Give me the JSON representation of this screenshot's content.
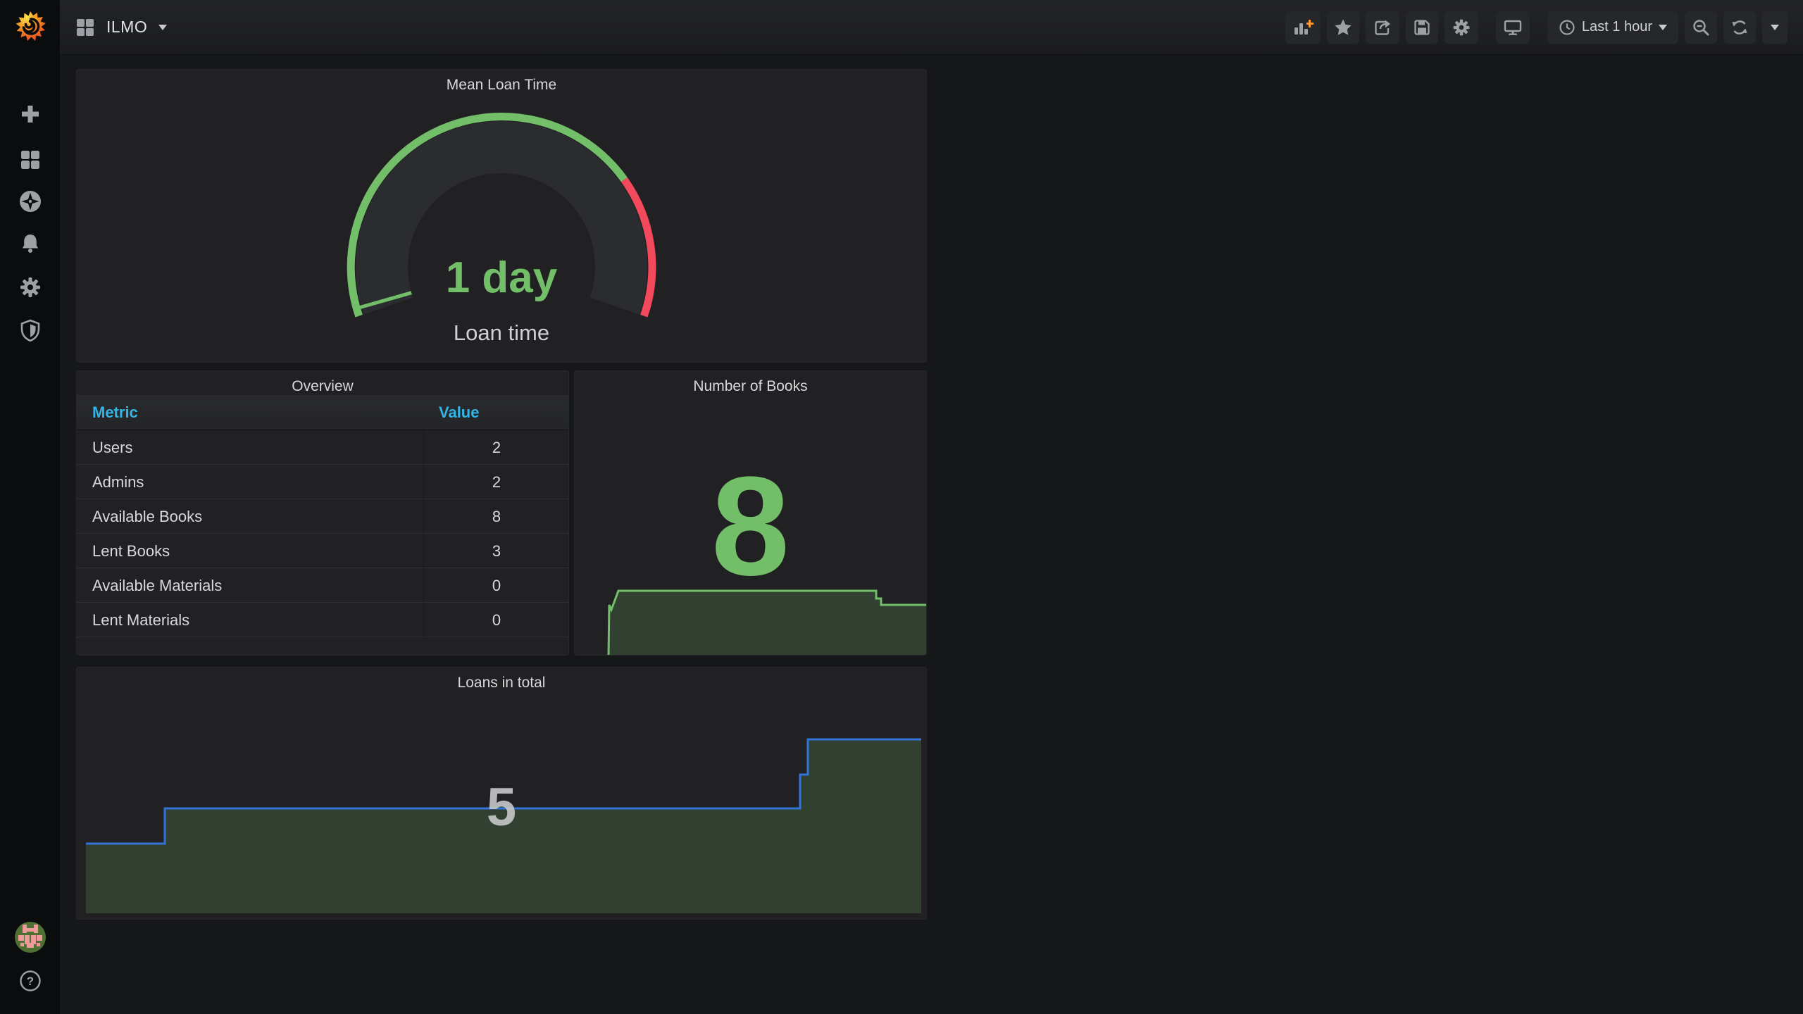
{
  "app": {
    "name": "Grafana"
  },
  "navbar": {
    "dashboard_title": "ILMO",
    "time_picker": {
      "label": "Last 1 hour"
    }
  },
  "sidebar": {
    "items": [
      "create",
      "dashboards",
      "explore",
      "alerting",
      "configuration",
      "server-admin"
    ],
    "bottom_items": [
      "user-avatar",
      "help"
    ]
  },
  "panels": {
    "mean_loan_time": {
      "title": "Mean Loan Time",
      "value": "1 day",
      "label": "Loan time"
    },
    "overview": {
      "title": "Overview",
      "columns": [
        "Metric",
        "Value"
      ],
      "rows": [
        [
          "Users",
          "2"
        ],
        [
          "Admins",
          "2"
        ],
        [
          "Available Books",
          "8"
        ],
        [
          "Lent Books",
          "3"
        ],
        [
          "Available Materials",
          "0"
        ],
        [
          "Lent Materials",
          "0"
        ]
      ]
    },
    "number_of_books": {
      "title": "Number of Books",
      "value": "8"
    },
    "loans_in_total": {
      "title": "Loans in total",
      "value": "5"
    }
  },
  "chart_data": [
    {
      "type": "gauge",
      "title": "Mean Loan Time",
      "value_text": "1 day",
      "label": "Loan time",
      "arc_sweep_degrees": 218,
      "thresholds": [
        {
          "color": "#73bf69",
          "from_fraction": 0.0,
          "to_fraction": 0.75
        },
        {
          "color": "#f2495c",
          "from_fraction": 0.75,
          "to_fraction": 1.0
        }
      ],
      "pointer_fraction": 0.01
    },
    {
      "type": "table",
      "title": "Overview",
      "columns": [
        "Metric",
        "Value"
      ],
      "rows": [
        [
          "Users",
          2
        ],
        [
          "Admins",
          2
        ],
        [
          "Available Books",
          8
        ],
        [
          "Lent Books",
          3
        ],
        [
          "Available Materials",
          0
        ],
        [
          "Lent Materials",
          0
        ]
      ]
    },
    {
      "type": "area",
      "title": "Number of Books",
      "current_value": 8,
      "values": [
        0,
        8,
        7,
        10,
        10,
        10,
        9,
        8
      ],
      "line_color": "#73bf69",
      "fill_color": "rgba(115,191,105,0.2)",
      "x_range": "Last 1 hour",
      "axes_hidden": true
    },
    {
      "type": "area",
      "title": "Loans in total",
      "current_value": 5,
      "values": [
        2,
        2,
        3,
        3,
        3,
        3,
        4,
        5,
        5
      ],
      "line_color": "#3274d9",
      "fill_color": "rgba(115,191,105,0.2)",
      "x_range": "Last 1 hour",
      "axes_hidden": true
    }
  ],
  "colors": {
    "green": "#73bf69",
    "red": "#f2495c",
    "blue_line": "#3274d9",
    "table_header_blue": "#33b5e5",
    "panel_bg": "#212124",
    "dashboard_bg": "#161719",
    "sidebar_bg": "#0b0c0e",
    "accent_orange": "#ff9830"
  }
}
